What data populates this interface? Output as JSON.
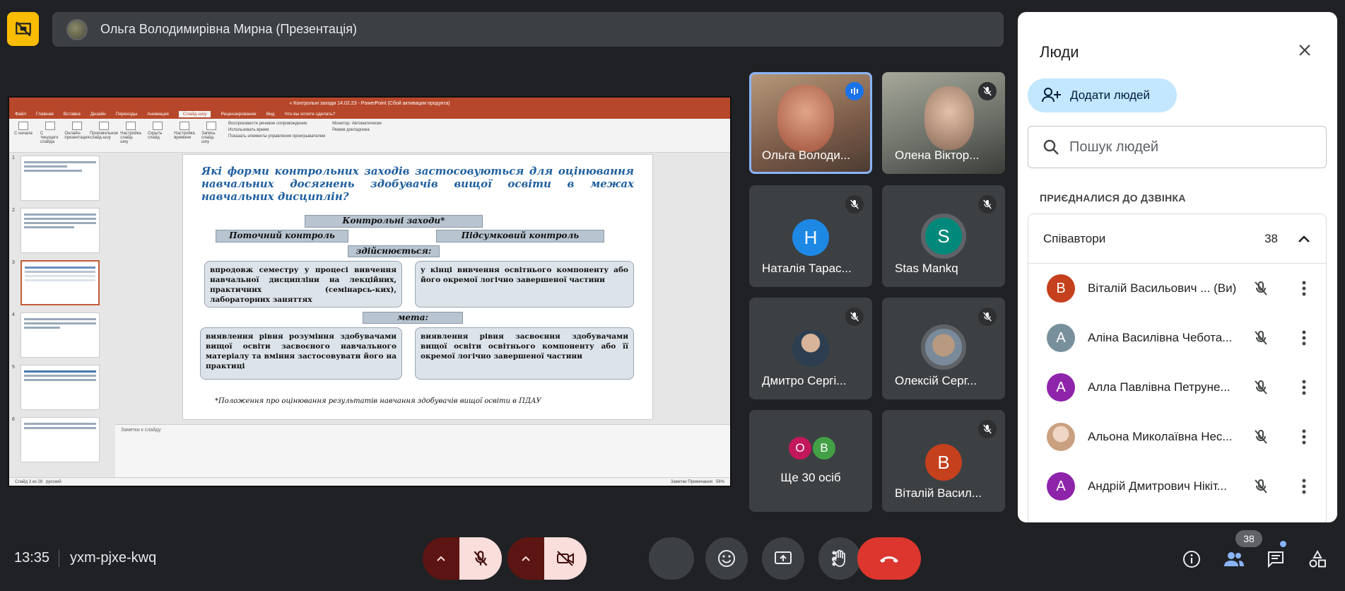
{
  "meeting": {
    "presenter_title": "Ольга Володимирівна Мирна (Презентація)",
    "time": "13:35",
    "code": "yxm-pjxe-kwq"
  },
  "powerpoint": {
    "window_title": "« Контрольні заходи 14.02.23 - PowerPoint (Сбой активации продукта)",
    "tabs": [
      "Файл",
      "Главная",
      "Вставка",
      "Дизайн",
      "Переходы",
      "Анимация",
      "Слайд-шоу",
      "Рецензирование",
      "Вид",
      "Что вы хотите сделать?"
    ],
    "active_tab": "Слайд-шоу",
    "ribbon_buttons": [
      "С начала",
      "С текущего слайда",
      "Онлайн-презентация",
      "Произвольное слайд-шоу",
      "Настройка слайд-шоу",
      "Скрыть слайд",
      "Настройка времени",
      "Запись слайд-шоу"
    ],
    "ribbon_checks": [
      "Воспроизвести речевое сопровождение",
      "Использовать время",
      "Показать элементы управления проигрывателем"
    ],
    "monitor_label": "Монитор:",
    "monitor_value": "Автоматически",
    "presenter_mode": "Режим докладчика",
    "notes_placeholder": "Заметки к слайду",
    "status_left": "Слайд 3 из 28",
    "status_lang": "русский",
    "status_right": "Заметки   Примечания",
    "zoom": "56%",
    "thumb_numbers": [
      "1",
      "2",
      "3",
      "4",
      "5",
      "6"
    ],
    "slide": {
      "title": "Які форми контрольних заходів застосовуються для оцінювання навчальних досягнень здобувачів вищої освіти в межах навчальних дисциплін?",
      "control": "Контрольні заходи*",
      "current": "Поточний контроль",
      "final": "Підсумковий контроль",
      "carried_out": "здійснюється:",
      "box1": "впродовж семестру у процесі вивчення навчальної дисципліни на лекційних, практичних (семінарсь-ких), лабораторних заняттях",
      "box2": "у кінці вивчення освітнього компоненту або його окремої логічно завершеної частини",
      "goal": "мета:",
      "box3": "виявлення рівня розуміння здобувачами вищої освіти засвоєного навчального матеріалу та вміння застосовувати його на практиці",
      "box4": "виявлення рівня засвоєння здобувачами вищої освіти освітнього компоненту або її окремої логічно завершеної частини",
      "footnote": "*Положення про оцінювання результатів навчання здобувачів вищої освіти в ПДАУ"
    }
  },
  "tiles": [
    {
      "name": "Ольга Володи...",
      "initial": "",
      "color": "",
      "speaking": true
    },
    {
      "name": "Олена Віктор...",
      "initial": "",
      "color": "",
      "muted": true
    },
    {
      "name": "Наталія Тарас...",
      "initial": "Н",
      "color": "#1e88e5",
      "muted": true
    },
    {
      "name": "Stas Mankq",
      "initial": "S",
      "color": "#00897b",
      "muted": true
    },
    {
      "name": "Дмитро Сергі...",
      "initial": "",
      "color": "",
      "muted": true
    },
    {
      "name": "Олексій Серг...",
      "initial": "",
      "color": "",
      "muted": true
    },
    {
      "name": "Ще 30 осіб",
      "initials": [
        "О",
        "В"
      ],
      "colors": [
        "#c2185b",
        "#43a047"
      ]
    },
    {
      "name": "Віталій Васил...",
      "initial": "В",
      "color": "#c5401c",
      "muted": true
    }
  ],
  "people_panel": {
    "title": "Люди",
    "add_people": "Додати людей",
    "search_placeholder": "Пошук людей",
    "section": "ПРИЄДНАЛИСЯ ДО ДЗВІНКА",
    "group_name": "Співавтори",
    "group_count": "38",
    "people": [
      {
        "name": "Віталій Васильович ... (Ви)",
        "initial": "В",
        "color": "#c5401c"
      },
      {
        "name": "Аліна Василівна Чебота...",
        "initial": "А",
        "color": "#78909c"
      },
      {
        "name": "Алла Павлівна Петруне...",
        "initial": "А",
        "color": "#8e24aa"
      },
      {
        "name": "Альона Миколаївна Нес...",
        "initial": "",
        "color": "#d7b8a0"
      },
      {
        "name": "Андрій Дмитрович Нікіт...",
        "initial": "А",
        "color": "#8e24aa"
      }
    ]
  },
  "bottom_bar": {
    "people_count": "38"
  }
}
